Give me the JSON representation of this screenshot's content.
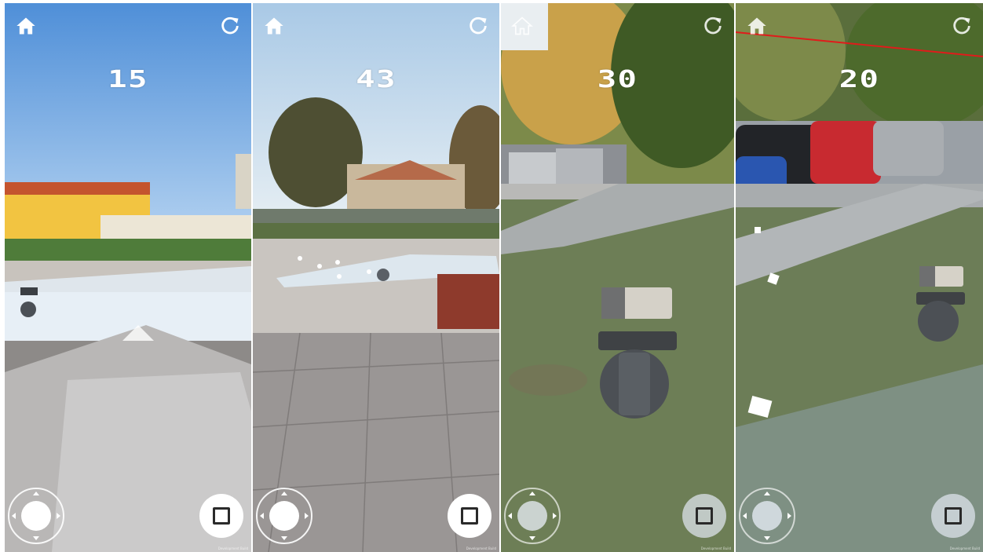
{
  "panels": [
    {
      "id": "p1",
      "score": "15",
      "home_icon": "home-icon",
      "restart_icon": "restart-icon",
      "joystick_icon": "joystick-icon",
      "stop_icon": "stop-square-icon",
      "credit": "Development Build"
    },
    {
      "id": "p2",
      "score": "43",
      "home_icon": "home-icon",
      "restart_icon": "restart-icon",
      "joystick_icon": "joystick-icon",
      "stop_icon": "stop-square-icon",
      "credit": "Development Build"
    },
    {
      "id": "p3",
      "score": "30",
      "home_icon": "home-icon",
      "restart_icon": "restart-icon",
      "joystick_icon": "joystick-icon",
      "stop_icon": "stop-square-icon",
      "credit": "Development Build"
    },
    {
      "id": "p4",
      "score": "20",
      "home_icon": "home-icon",
      "restart_icon": "restart-icon",
      "joystick_icon": "joystick-icon",
      "stop_icon": "stop-square-icon",
      "credit": "Development Build"
    }
  ],
  "colors": {
    "ui_white": "#ffffff",
    "stop_square": "#2a2a2a",
    "laser_line": "#e01b1b"
  }
}
